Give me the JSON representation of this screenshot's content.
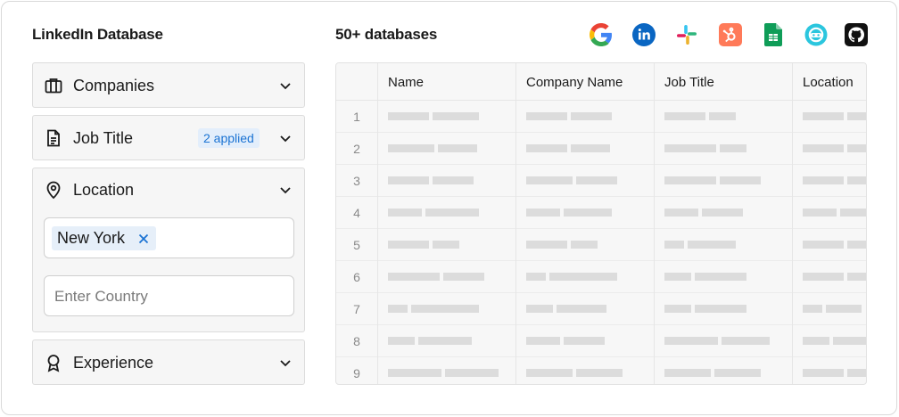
{
  "left_panel": {
    "title": "LinkedIn Database",
    "filters": {
      "companies": {
        "label": "Companies",
        "icon": "briefcase-icon"
      },
      "job_title": {
        "label": "Job Title",
        "icon": "document-icon",
        "badge": "2 applied"
      },
      "location": {
        "label": "Location",
        "icon": "map-pin-icon",
        "chip": "New York",
        "country_placeholder": "Enter Country"
      },
      "experience": {
        "label": "Experience",
        "icon": "award-icon"
      }
    }
  },
  "right_panel": {
    "title": "50+ databases",
    "integrations": [
      "google-icon",
      "linkedin-icon",
      "slack-icon",
      "hubspot-icon",
      "google-sheets-icon",
      "chatgpt-icon",
      "github-icon"
    ],
    "table": {
      "columns": [
        "Name",
        "Company Name",
        "Job Title",
        "Location"
      ],
      "row_numbers": [
        "1",
        "2",
        "3",
        "4",
        "5",
        "6",
        "7",
        "8",
        "9"
      ]
    }
  },
  "colors": {
    "badge_text": "#1b73d3",
    "badge_bg": "#e3eefb",
    "chip_bg": "#e6eff9",
    "skeleton": "#dcdcdc",
    "panel_bg": "#f6f6f6"
  }
}
